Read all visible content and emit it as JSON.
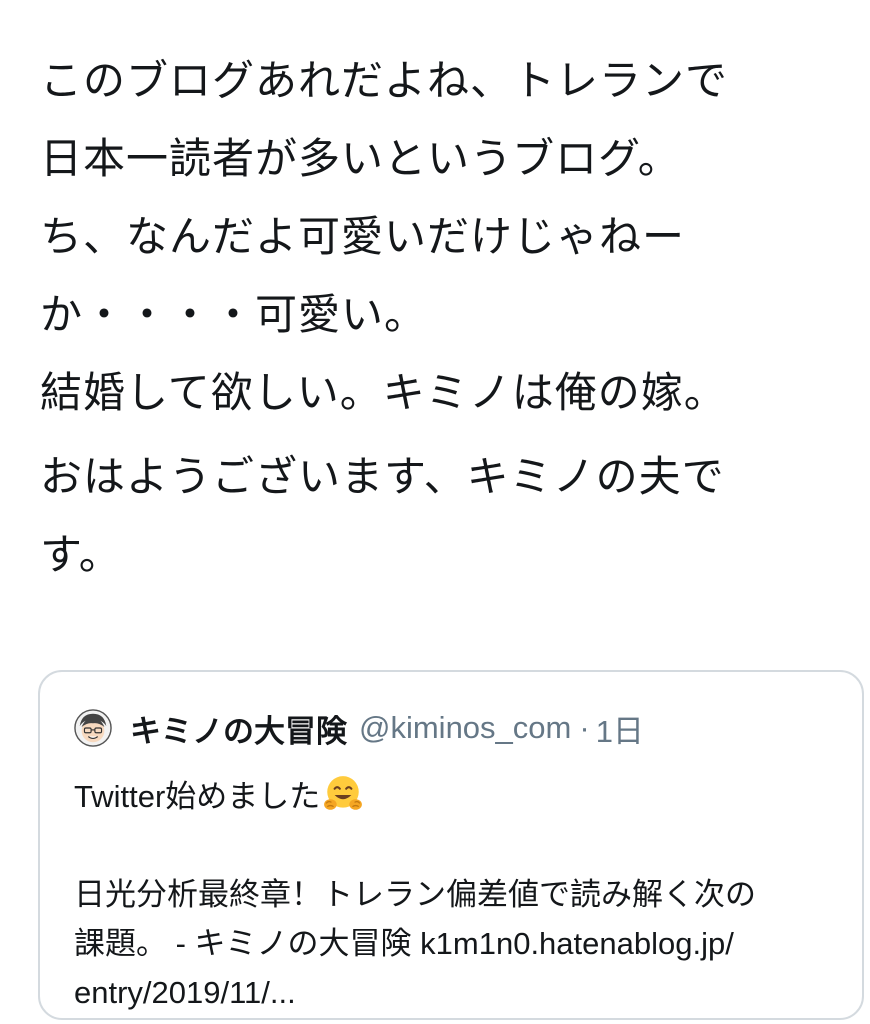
{
  "tweet": {
    "lines_para1": [
      "このブログあれだよね、トレランで",
      "日本一読者が多いというブログ。",
      "ち、なんだよ可愛いだけじゃねー",
      "か・・・・可愛い。",
      "結婚して欲しい。キミノは俺の嫁。"
    ],
    "lines_para2": [
      "おはようございます、キミノの夫で",
      "す。"
    ]
  },
  "quoted_tweet": {
    "display_name": "キミノの大冒険",
    "handle": "@kiminos_com",
    "separator": "·",
    "time": "1日",
    "text_line1": "Twitter始めました",
    "emoji_icon": "hugging-face-emoji",
    "link_lines": [
      "日光分析最終章！トレラン偏差値で読み解く次の",
      "課題。 - キミノの大冒険 k1m1n0.hatenablog.jp/",
      "entry/2019/11/..."
    ]
  },
  "colors": {
    "text_primary": "#14171a",
    "text_secondary": "#657786",
    "card_border": "#d4dadf"
  }
}
